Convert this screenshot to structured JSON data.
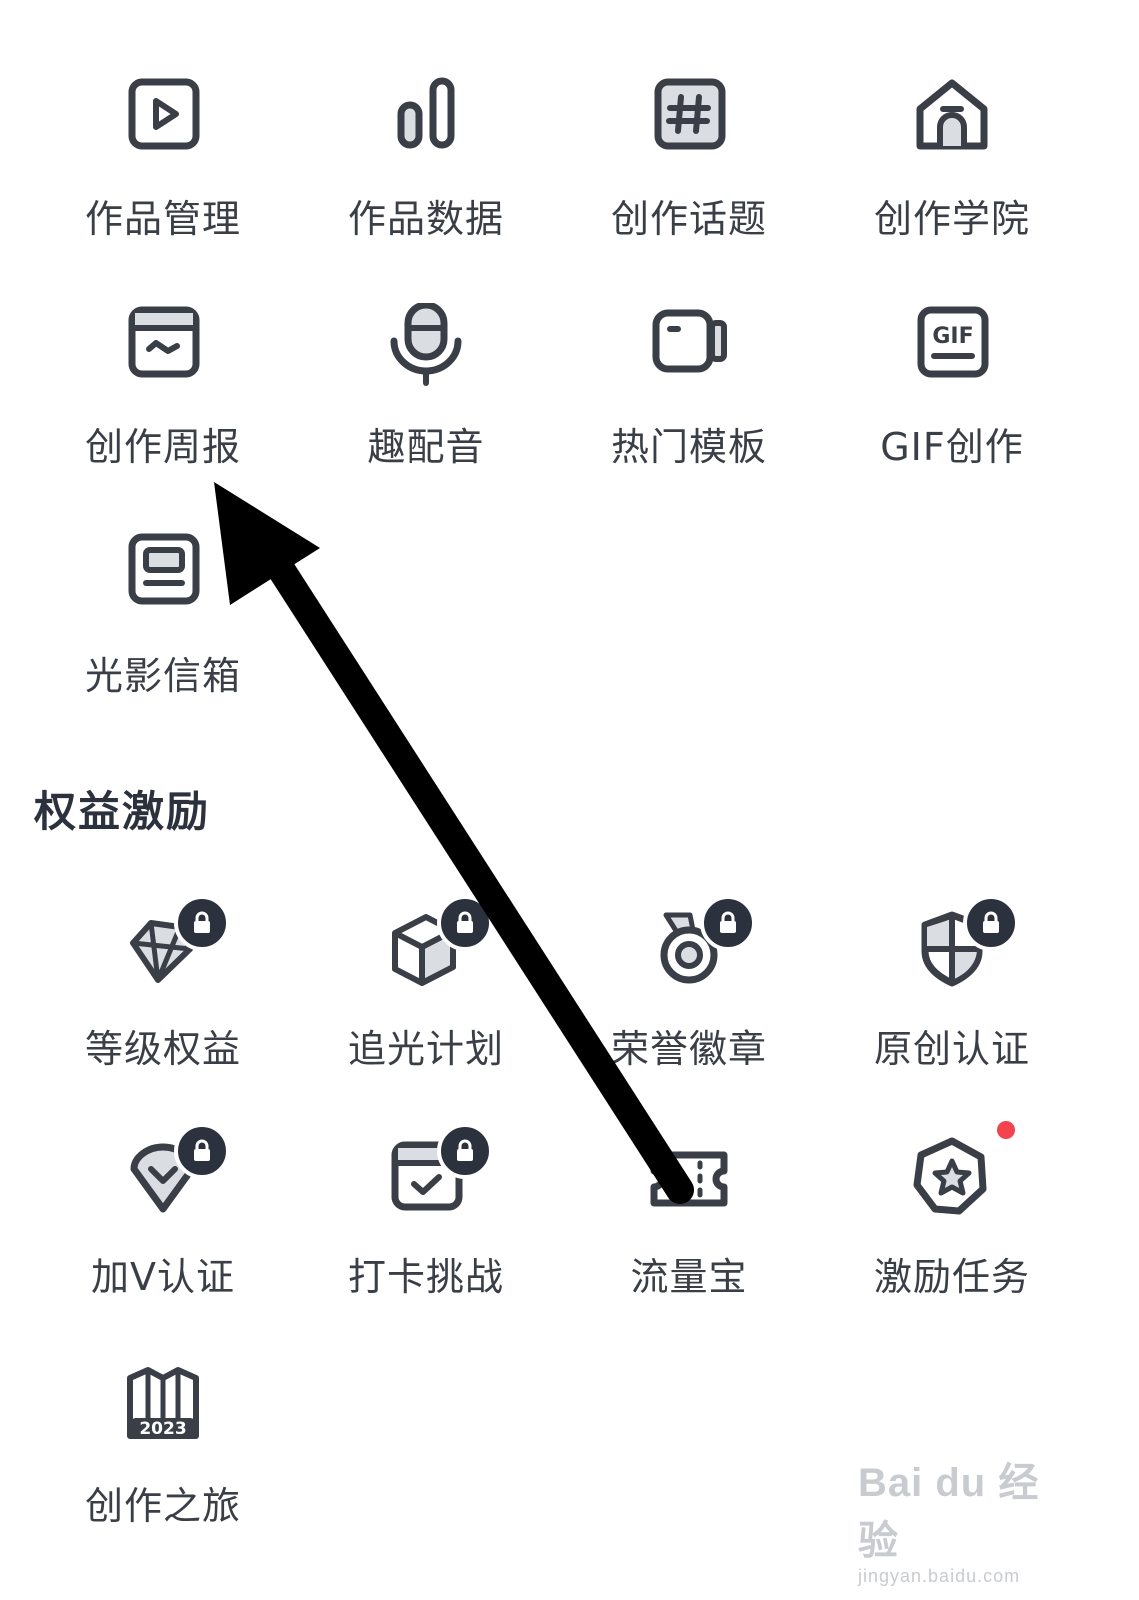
{
  "tools": {
    "items": [
      {
        "label": "作品管理",
        "icon": "play-video-icon"
      },
      {
        "label": "作品数据",
        "icon": "bar-chart-icon"
      },
      {
        "label": "创作话题",
        "icon": "hashtag-icon"
      },
      {
        "label": "创作学院",
        "icon": "academy-house-icon"
      },
      {
        "label": "创作周报",
        "icon": "weekly-report-icon"
      },
      {
        "label": "趣配音",
        "icon": "microphone-icon"
      },
      {
        "label": "热门模板",
        "icon": "video-template-icon"
      },
      {
        "label": "GIF创作",
        "icon": "gif-icon"
      },
      {
        "label": "光影信箱",
        "icon": "mailbox-monitor-icon"
      }
    ]
  },
  "rights": {
    "title": "权益激励",
    "items": [
      {
        "label": "等级权益",
        "icon": "diamond-icon",
        "locked": true
      },
      {
        "label": "追光计划",
        "icon": "cube-icon",
        "locked": true
      },
      {
        "label": "荣誉徽章",
        "icon": "medal-icon",
        "locked": true
      },
      {
        "label": "原创认证",
        "icon": "shield-icon",
        "locked": true
      },
      {
        "label": "加V认证",
        "icon": "v-badge-icon",
        "locked": true
      },
      {
        "label": "打卡挑战",
        "icon": "calendar-check-icon",
        "locked": true
      },
      {
        "label": "流量宝",
        "icon": "ticket-icon",
        "locked": false
      },
      {
        "label": "激励任务",
        "icon": "star-badge-icon",
        "locked": false,
        "notification_dot": true
      },
      {
        "label": "创作之旅",
        "icon": "map-2023-icon",
        "locked": false,
        "year_text": "2023"
      }
    ]
  },
  "watermark": {
    "brand": "Bai du 经验",
    "url": "jingyan.baidu.com"
  },
  "colors": {
    "icon_stroke": "#3a3f47",
    "icon_fill": "#dadde2",
    "text": "#3a3f47",
    "lock_bg": "#2c323d",
    "dot": "#f2434f",
    "arrow": "#000000"
  }
}
